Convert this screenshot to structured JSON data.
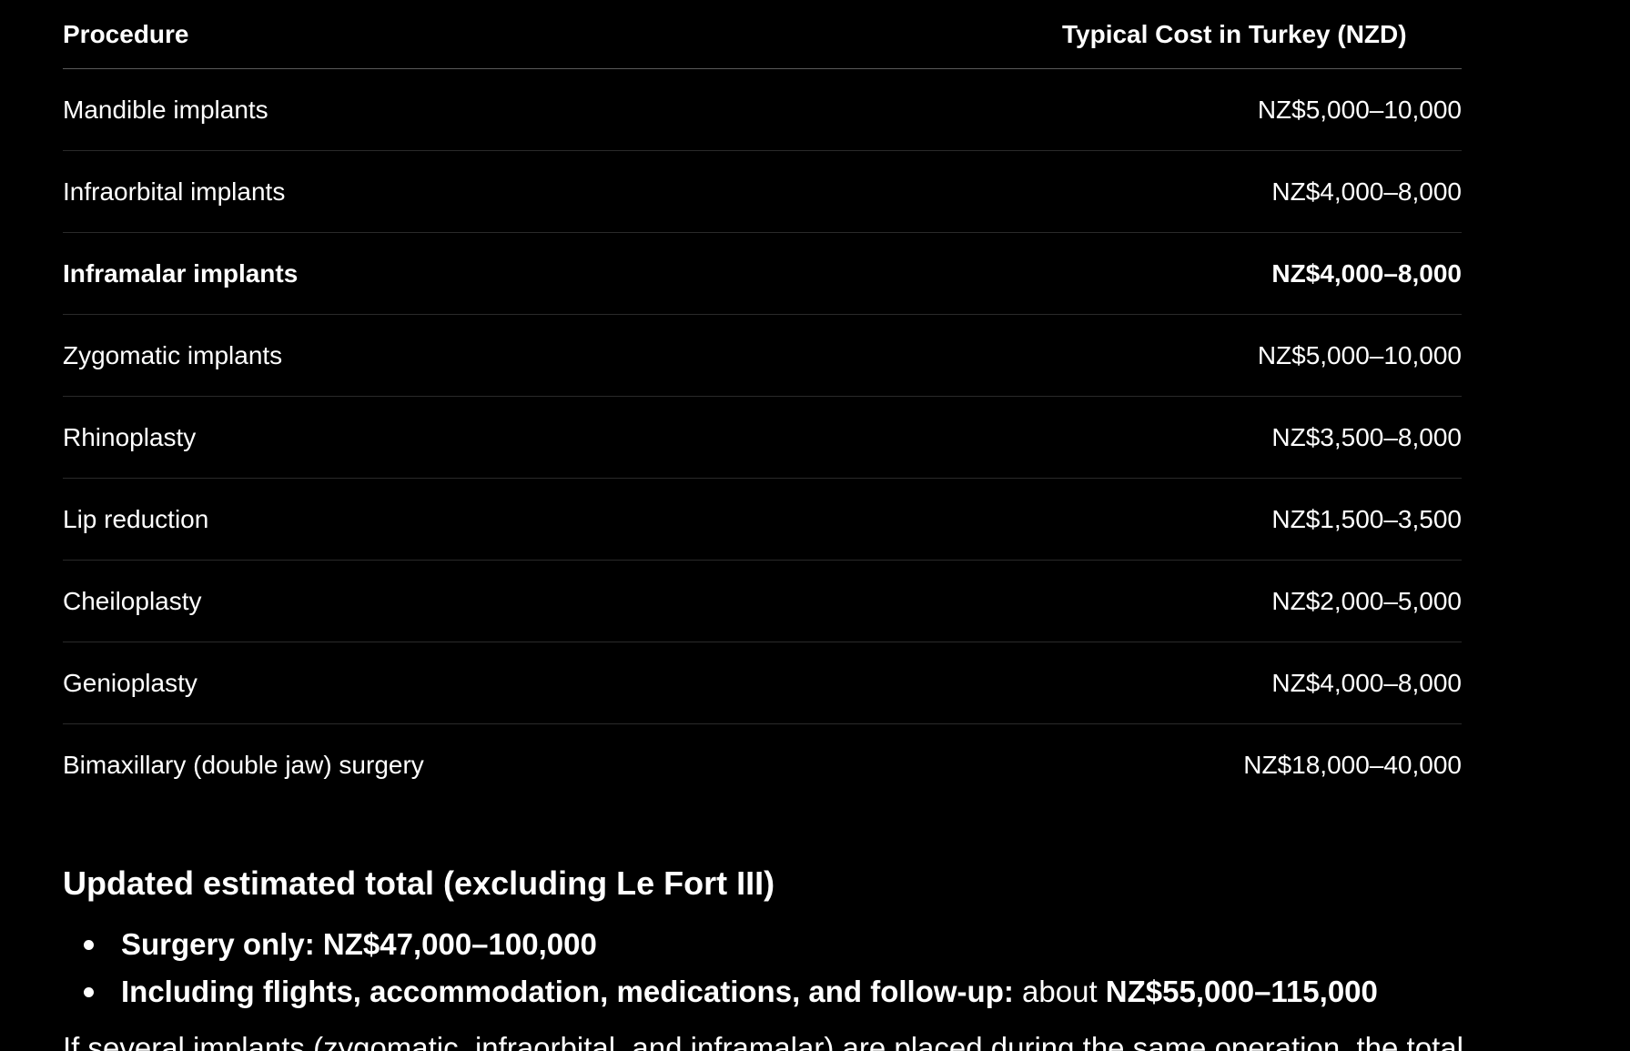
{
  "table": {
    "headers": {
      "procedure": "Procedure",
      "cost": "Typical Cost in Turkey (NZD)"
    },
    "rows": [
      {
        "procedure": "Mandible implants",
        "cost": "NZ$5,000–10,000",
        "bold": false
      },
      {
        "procedure": "Infraorbital implants",
        "cost": "NZ$4,000–8,000",
        "bold": false
      },
      {
        "procedure": "Inframalar implants",
        "cost": "NZ$4,000–8,000",
        "bold": true
      },
      {
        "procedure": "Zygomatic implants",
        "cost": "NZ$5,000–10,000",
        "bold": false
      },
      {
        "procedure": "Rhinoplasty",
        "cost": "NZ$3,500–8,000",
        "bold": false
      },
      {
        "procedure": "Lip reduction",
        "cost": "NZ$1,500–3,500",
        "bold": false
      },
      {
        "procedure": "Cheiloplasty",
        "cost": "NZ$2,000–5,000",
        "bold": false
      },
      {
        "procedure": "Genioplasty",
        "cost": "NZ$4,000–8,000",
        "bold": false
      },
      {
        "procedure": "Bimaxillary (double jaw) surgery",
        "cost": "NZ$18,000–40,000",
        "bold": false
      }
    ]
  },
  "summary": {
    "heading": "Updated estimated total (excluding Le Fort III)",
    "items": [
      {
        "label": "Surgery only:",
        "text": "",
        "value": "NZ$47,000–100,000"
      },
      {
        "label": "Including flights, accommodation, medications, and follow-up:",
        "text": "about",
        "value": "NZ$55,000–115,000"
      }
    ],
    "trailing_text": "If several implants (zygomatic, infraorbital, and inframalar) are placed during the same operation, the total"
  }
}
